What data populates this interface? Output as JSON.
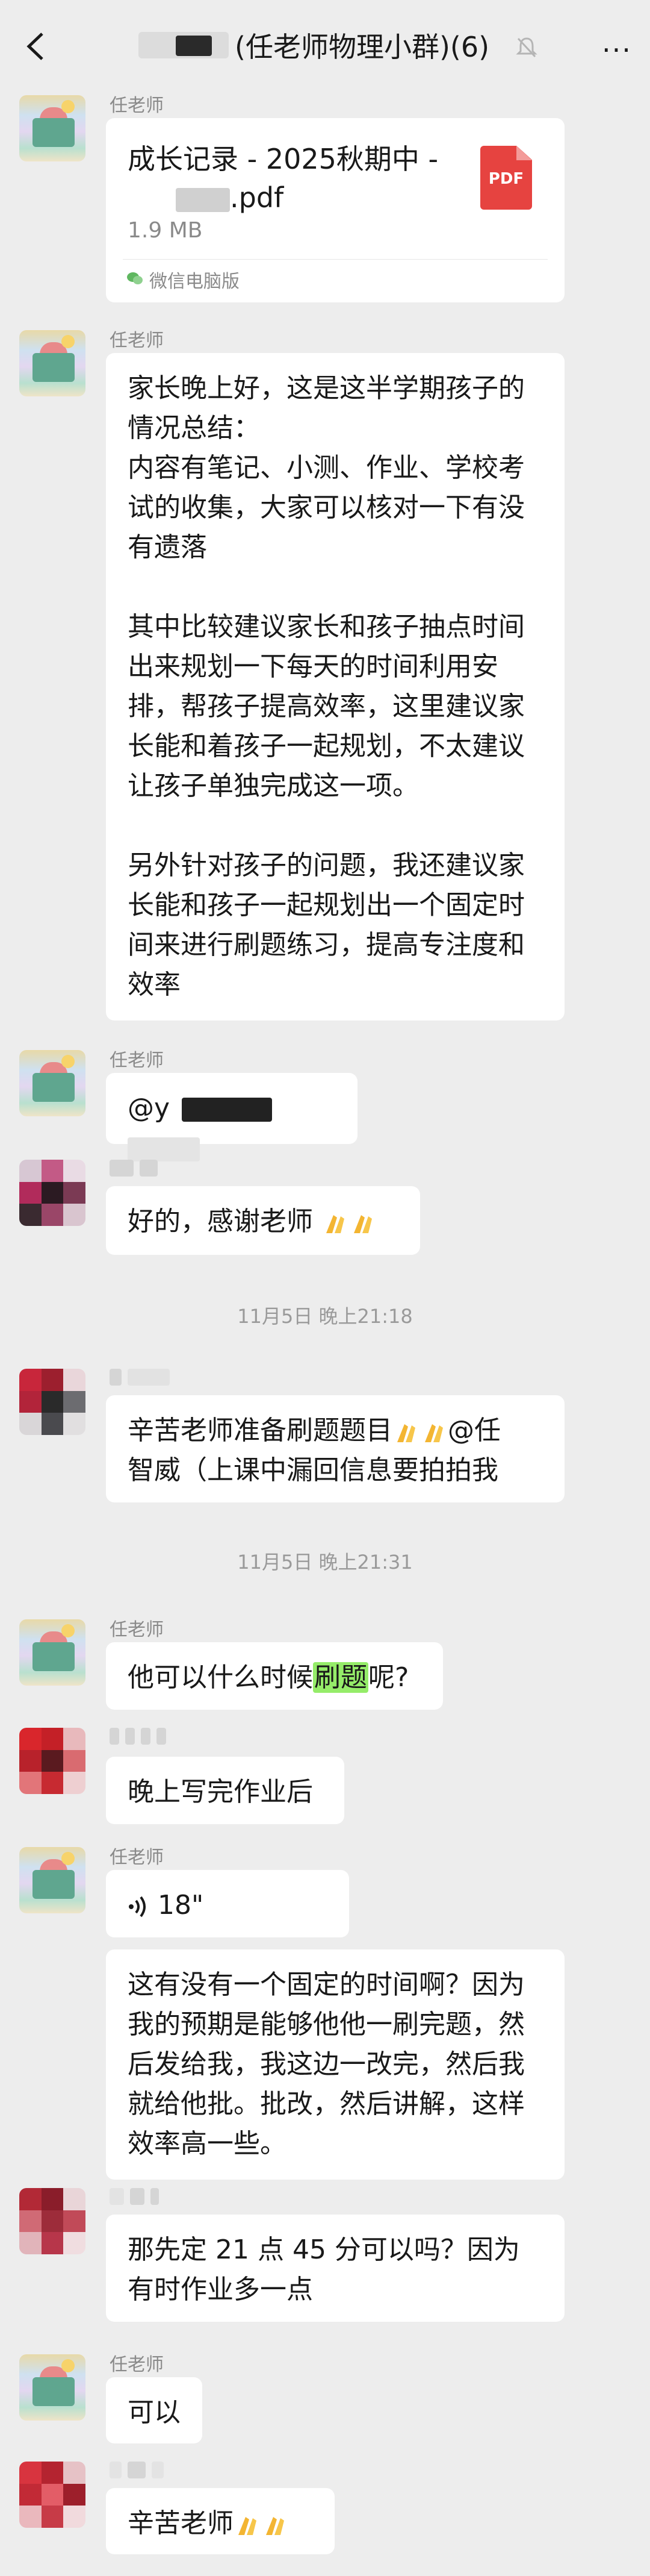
{
  "header": {
    "title": "(任老师物理小群)(6)",
    "more_label": "···"
  },
  "messages": {
    "m1": {
      "sender": "任老师",
      "file_name_line1": "成长记录 - 2025秋期中 -",
      "file_name_line2": ".pdf",
      "file_size": "1.9 MB",
      "file_icon_label": "PDF",
      "source": "微信电脑版"
    },
    "m2": {
      "sender": "任老师",
      "p1": "家长晚上好，这是这半学期孩子的情况总结：",
      "p2": "内容有笔记、小测、作业、学校考试的收集，大家可以核对一下有没有遗落",
      "p3": "其中比较建议家长和孩子抽点时间出来规划一下每天的时间利用安排，帮孩子提高效率，这里建议家长能和着孩子一起规划，不太建议让孩子单独完成这一项。",
      "p4": "另外针对孩子的问题，我还建议家长能和孩子一起规划出一个固定时间来进行刷题练习，提高专注度和效率"
    },
    "m3": {
      "sender": "任老师",
      "text": "@y"
    },
    "m4": {
      "text": "好的，感谢老师"
    },
    "t1": "11月5日 晚上21:18",
    "m5": {
      "line1": "辛苦老师准备刷题题目",
      "line1_tail": "@任",
      "line2": "智威（上课中漏回信息要拍拍我"
    },
    "t2": "11月5日 晚上21:31",
    "m6": {
      "sender": "任老师",
      "text_before": "他可以什么时候",
      "text_highlight": "刷题",
      "text_after": "呢?"
    },
    "m7": {
      "text": "晚上写完作业后"
    },
    "m8": {
      "sender": "任老师",
      "voice": "18\"",
      "text": "这有没有一个固定的时间啊？因为我的预期是能够他他一刷完题，然后发给我，我这边一改完，然后我就给他批。批改，然后讲解，这样效率高一些。"
    },
    "m9": {
      "text": "那先定 21 点 45 分可以吗？因为有时作业多一点"
    },
    "m10": {
      "sender": "任老师",
      "text": "可以"
    },
    "m11": {
      "text": "辛苦老师"
    }
  }
}
